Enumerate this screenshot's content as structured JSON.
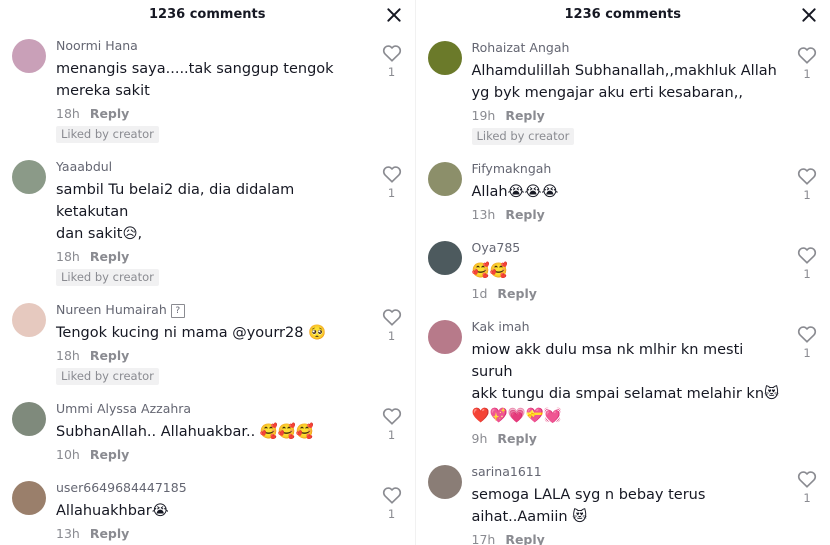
{
  "left": {
    "title": "1236 comments",
    "comments": [
      {
        "user": "Noormi Hana",
        "text": "menangis saya.....tak sanggup tengok\nmereka sakit",
        "time": "18h",
        "reply": "Reply",
        "liked": "Liked by creator",
        "likes": "1",
        "avatar_color": "#c9a0b8"
      },
      {
        "user": "Yaaabdul",
        "text": "sambil Tu belai2 dia, dia didalam ketakutan\ndan sakit😥,",
        "time": "18h",
        "reply": "Reply",
        "liked": "Liked by creator",
        "likes": "1",
        "avatar_color": "#8b9a88"
      },
      {
        "user": "Nureen Humairah",
        "badge": "?",
        "text": "Tengok kucing ni mama @yourr28 🥺",
        "time": "18h",
        "reply": "Reply",
        "liked": "Liked by creator",
        "likes": "1",
        "avatar_color": "#e6c9bf"
      },
      {
        "user": "Ummi Alyssa Azzahra",
        "text": "SubhanAllah.. Allahuakbar.. 🥰🥰🥰",
        "time": "10h",
        "reply": "Reply",
        "likes": "1",
        "avatar_color": "#7f8a7c"
      },
      {
        "user": "user6649684447185",
        "text": "Allahuakhbar😭",
        "time": "13h",
        "reply": "Reply",
        "likes": "1",
        "avatar_color": "#9a7f6b"
      }
    ]
  },
  "right": {
    "title": "1236 comments",
    "comments": [
      {
        "user": "Rohaizat Angah",
        "text": "Alhamdulillah Subhanallah,,makhluk Allah\nyg byk mengajar aku erti kesabaran,,",
        "time": "19h",
        "reply": "Reply",
        "liked": "Liked by creator",
        "likes": "1",
        "avatar_color": "#6b7a2a"
      },
      {
        "user": "Fifymakngah",
        "text": "Allah😭😭😭",
        "time": "13h",
        "reply": "Reply",
        "likes": "1",
        "avatar_color": "#8c8f6a"
      },
      {
        "user": "Oya785",
        "text": "🥰🥰",
        "time": "1d",
        "reply": "Reply",
        "likes": "1",
        "avatar_color": "#4d5a5e"
      },
      {
        "user": "Kak imah",
        "text": "miow akk dulu msa nk mlhir kn mesti suruh\nakk tungu dia smpai selamat melahir kn😻\n❤️💖💗💝💓",
        "time": "9h",
        "reply": "Reply",
        "likes": "1",
        "avatar_color": "#b77a8a"
      },
      {
        "user": "sarina1611",
        "text": "semoga LALA syg n bebay terus\naihat..Aamiin 😻",
        "time": "17h",
        "reply": "Reply",
        "likes": "1",
        "avatar_color": "#8a7d76"
      }
    ]
  }
}
